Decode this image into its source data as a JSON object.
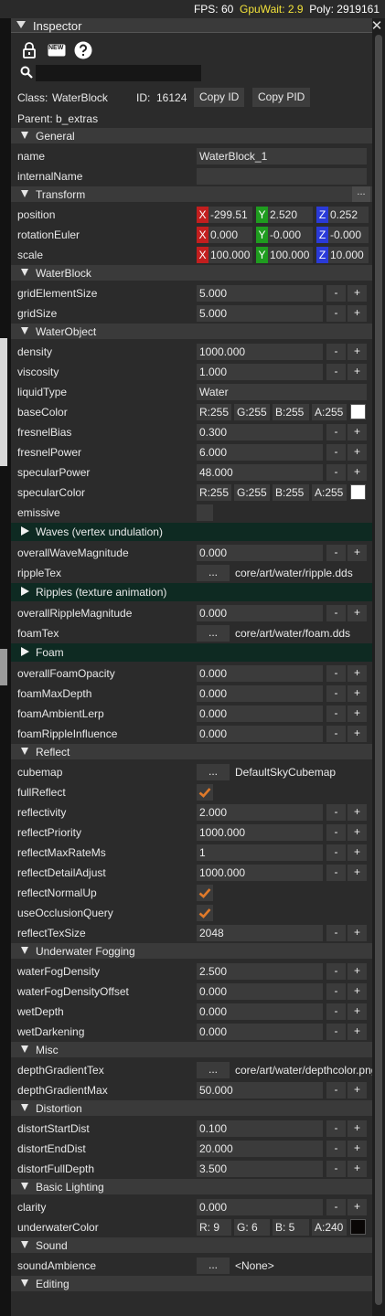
{
  "stats": {
    "fps": "FPS: 60",
    "gpuwait": "GpuWait: 2.9",
    "poly": "Poly: 2919161"
  },
  "window": {
    "title": "Inspector",
    "close": "✕"
  },
  "toolbar": {
    "new_label": "NEW"
  },
  "search": {
    "placeholder": "",
    "value": ""
  },
  "object": {
    "class_label": "Class:",
    "class_value": "WaterBlock",
    "id_label": "ID:",
    "id_value": "16124",
    "copy_id": "Copy ID",
    "copy_pid": "Copy PID",
    "parent_label": "Parent:",
    "parent_value": "b_extras"
  },
  "colors": {
    "accent_check": "#e07a2a",
    "axis_x": "#c21e1e",
    "axis_y": "#1f9c1f",
    "axis_z": "#2a3ad8",
    "collapsed_header": "#0e2a22"
  },
  "rows": [
    {
      "t": "section",
      "label": "General"
    },
    {
      "t": "text",
      "name": "name",
      "value": "WaterBlock_1"
    },
    {
      "t": "text",
      "name": "internalName",
      "value": ""
    },
    {
      "t": "section",
      "label": "Transform",
      "dots": "..."
    },
    {
      "t": "vec",
      "name": "position",
      "x": "-299.51",
      "y": "2.520",
      "z": "0.252"
    },
    {
      "t": "vec",
      "name": "rotationEuler",
      "x": "0.000",
      "y": "-0.000",
      "z": "-0.000"
    },
    {
      "t": "vec",
      "name": "scale",
      "x": "100.000",
      "y": "100.000",
      "z": "10.000"
    },
    {
      "t": "section",
      "label": "WaterBlock"
    },
    {
      "t": "num",
      "name": "gridElementSize",
      "value": "5.000"
    },
    {
      "t": "num",
      "name": "gridSize",
      "value": "5.000"
    },
    {
      "t": "section",
      "label": "WaterObject"
    },
    {
      "t": "num",
      "name": "density",
      "value": "1000.000"
    },
    {
      "t": "num",
      "name": "viscosity",
      "value": "1.000"
    },
    {
      "t": "text",
      "name": "liquidType",
      "value": "Water"
    },
    {
      "t": "color",
      "name": "baseColor",
      "r": "R:255",
      "g": "G:255",
      "b": "B:255",
      "a": "A:255",
      "swatch": "#ffffff"
    },
    {
      "t": "num",
      "name": "fresnelBias",
      "value": "0.300"
    },
    {
      "t": "num",
      "name": "fresnelPower",
      "value": "6.000"
    },
    {
      "t": "num",
      "name": "specularPower",
      "value": "48.000"
    },
    {
      "t": "color",
      "name": "specularColor",
      "r": "R:255",
      "g": "G:255",
      "b": "B:255",
      "a": "A:255",
      "swatch": "#ffffff"
    },
    {
      "t": "check",
      "name": "emissive",
      "checked": false
    },
    {
      "t": "csection",
      "label": "Waves (vertex undulation)"
    },
    {
      "t": "num",
      "name": "overallWaveMagnitude",
      "value": "0.000"
    },
    {
      "t": "file",
      "name": "rippleTex",
      "value": "core/art/water/ripple.dds"
    },
    {
      "t": "csection",
      "label": "Ripples (texture animation)"
    },
    {
      "t": "num",
      "name": "overallRippleMagnitude",
      "value": "0.000"
    },
    {
      "t": "file",
      "name": "foamTex",
      "value": "core/art/water/foam.dds"
    },
    {
      "t": "csection",
      "label": "Foam"
    },
    {
      "t": "num",
      "name": "overallFoamOpacity",
      "value": "0.000"
    },
    {
      "t": "num",
      "name": "foamMaxDepth",
      "value": "0.000"
    },
    {
      "t": "num",
      "name": "foamAmbientLerp",
      "value": "0.000"
    },
    {
      "t": "num",
      "name": "foamRippleInfluence",
      "value": "0.000"
    },
    {
      "t": "section",
      "label": "Reflect"
    },
    {
      "t": "file",
      "name": "cubemap",
      "value": "DefaultSkyCubemap"
    },
    {
      "t": "check",
      "name": "fullReflect",
      "checked": true
    },
    {
      "t": "num",
      "name": "reflectivity",
      "value": "2.000"
    },
    {
      "t": "num",
      "name": "reflectPriority",
      "value": "1000.000"
    },
    {
      "t": "num",
      "name": "reflectMaxRateMs",
      "value": "1"
    },
    {
      "t": "num",
      "name": "reflectDetailAdjust",
      "value": "1000.000"
    },
    {
      "t": "check",
      "name": "reflectNormalUp",
      "checked": true
    },
    {
      "t": "check",
      "name": "useOcclusionQuery",
      "checked": true
    },
    {
      "t": "num",
      "name": "reflectTexSize",
      "value": "2048"
    },
    {
      "t": "section",
      "label": "Underwater Fogging"
    },
    {
      "t": "num",
      "name": "waterFogDensity",
      "value": "2.500"
    },
    {
      "t": "num",
      "name": "waterFogDensityOffset",
      "value": "0.000"
    },
    {
      "t": "num",
      "name": "wetDepth",
      "value": "0.000"
    },
    {
      "t": "num",
      "name": "wetDarkening",
      "value": "0.000"
    },
    {
      "t": "section",
      "label": "Misc"
    },
    {
      "t": "file",
      "name": "depthGradientTex",
      "value": "core/art/water/depthcolor.png"
    },
    {
      "t": "num",
      "name": "depthGradientMax",
      "value": "50.000"
    },
    {
      "t": "section",
      "label": "Distortion"
    },
    {
      "t": "num",
      "name": "distortStartDist",
      "value": "0.100"
    },
    {
      "t": "num",
      "name": "distortEndDist",
      "value": "20.000"
    },
    {
      "t": "num",
      "name": "distortFullDepth",
      "value": "3.500"
    },
    {
      "t": "section",
      "label": "Basic Lighting"
    },
    {
      "t": "num",
      "name": "clarity",
      "value": "0.000"
    },
    {
      "t": "color",
      "name": "underwaterColor",
      "r": "R: 9",
      "g": "G: 6",
      "b": "B: 5",
      "a": "A:240",
      "swatch": "#090605"
    },
    {
      "t": "section",
      "label": "Sound"
    },
    {
      "t": "file",
      "name": "soundAmbience",
      "value": "<None>"
    },
    {
      "t": "section",
      "label": "Editing"
    }
  ],
  "labels": {
    "minus": "-",
    "plus": "+",
    "browse": "...",
    "x": "X",
    "y": "Y",
    "z": "Z"
  }
}
